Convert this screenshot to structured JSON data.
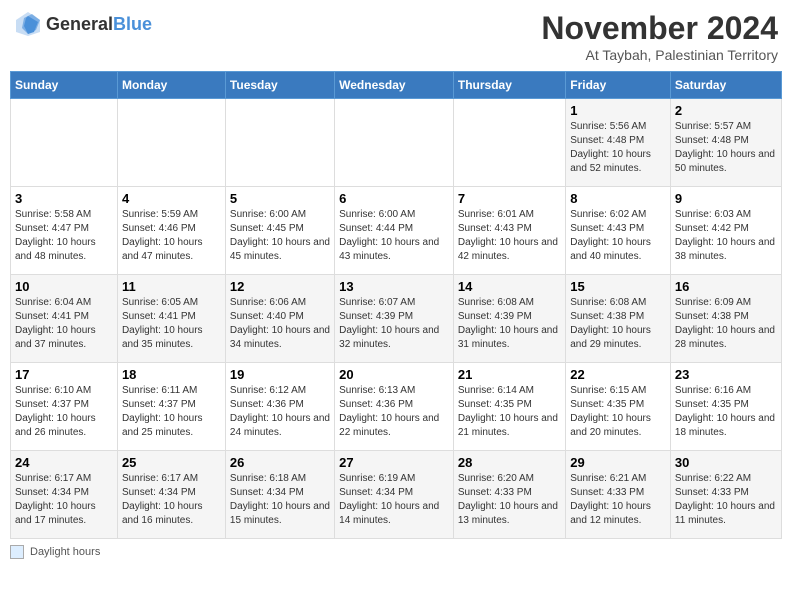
{
  "header": {
    "logo_general": "General",
    "logo_blue": "Blue",
    "month_title": "November 2024",
    "location": "At Taybah, Palestinian Territory"
  },
  "columns": [
    "Sunday",
    "Monday",
    "Tuesday",
    "Wednesday",
    "Thursday",
    "Friday",
    "Saturday"
  ],
  "weeks": [
    [
      {
        "day": "",
        "sunrise": "",
        "sunset": "",
        "daylight": ""
      },
      {
        "day": "",
        "sunrise": "",
        "sunset": "",
        "daylight": ""
      },
      {
        "day": "",
        "sunrise": "",
        "sunset": "",
        "daylight": ""
      },
      {
        "day": "",
        "sunrise": "",
        "sunset": "",
        "daylight": ""
      },
      {
        "day": "",
        "sunrise": "",
        "sunset": "",
        "daylight": ""
      },
      {
        "day": "1",
        "sunrise": "Sunrise: 5:56 AM",
        "sunset": "Sunset: 4:48 PM",
        "daylight": "Daylight: 10 hours and 52 minutes."
      },
      {
        "day": "2",
        "sunrise": "Sunrise: 5:57 AM",
        "sunset": "Sunset: 4:48 PM",
        "daylight": "Daylight: 10 hours and 50 minutes."
      }
    ],
    [
      {
        "day": "3",
        "sunrise": "Sunrise: 5:58 AM",
        "sunset": "Sunset: 4:47 PM",
        "daylight": "Daylight: 10 hours and 48 minutes."
      },
      {
        "day": "4",
        "sunrise": "Sunrise: 5:59 AM",
        "sunset": "Sunset: 4:46 PM",
        "daylight": "Daylight: 10 hours and 47 minutes."
      },
      {
        "day": "5",
        "sunrise": "Sunrise: 6:00 AM",
        "sunset": "Sunset: 4:45 PM",
        "daylight": "Daylight: 10 hours and 45 minutes."
      },
      {
        "day": "6",
        "sunrise": "Sunrise: 6:00 AM",
        "sunset": "Sunset: 4:44 PM",
        "daylight": "Daylight: 10 hours and 43 minutes."
      },
      {
        "day": "7",
        "sunrise": "Sunrise: 6:01 AM",
        "sunset": "Sunset: 4:43 PM",
        "daylight": "Daylight: 10 hours and 42 minutes."
      },
      {
        "day": "8",
        "sunrise": "Sunrise: 6:02 AM",
        "sunset": "Sunset: 4:43 PM",
        "daylight": "Daylight: 10 hours and 40 minutes."
      },
      {
        "day": "9",
        "sunrise": "Sunrise: 6:03 AM",
        "sunset": "Sunset: 4:42 PM",
        "daylight": "Daylight: 10 hours and 38 minutes."
      }
    ],
    [
      {
        "day": "10",
        "sunrise": "Sunrise: 6:04 AM",
        "sunset": "Sunset: 4:41 PM",
        "daylight": "Daylight: 10 hours and 37 minutes."
      },
      {
        "day": "11",
        "sunrise": "Sunrise: 6:05 AM",
        "sunset": "Sunset: 4:41 PM",
        "daylight": "Daylight: 10 hours and 35 minutes."
      },
      {
        "day": "12",
        "sunrise": "Sunrise: 6:06 AM",
        "sunset": "Sunset: 4:40 PM",
        "daylight": "Daylight: 10 hours and 34 minutes."
      },
      {
        "day": "13",
        "sunrise": "Sunrise: 6:07 AM",
        "sunset": "Sunset: 4:39 PM",
        "daylight": "Daylight: 10 hours and 32 minutes."
      },
      {
        "day": "14",
        "sunrise": "Sunrise: 6:08 AM",
        "sunset": "Sunset: 4:39 PM",
        "daylight": "Daylight: 10 hours and 31 minutes."
      },
      {
        "day": "15",
        "sunrise": "Sunrise: 6:08 AM",
        "sunset": "Sunset: 4:38 PM",
        "daylight": "Daylight: 10 hours and 29 minutes."
      },
      {
        "day": "16",
        "sunrise": "Sunrise: 6:09 AM",
        "sunset": "Sunset: 4:38 PM",
        "daylight": "Daylight: 10 hours and 28 minutes."
      }
    ],
    [
      {
        "day": "17",
        "sunrise": "Sunrise: 6:10 AM",
        "sunset": "Sunset: 4:37 PM",
        "daylight": "Daylight: 10 hours and 26 minutes."
      },
      {
        "day": "18",
        "sunrise": "Sunrise: 6:11 AM",
        "sunset": "Sunset: 4:37 PM",
        "daylight": "Daylight: 10 hours and 25 minutes."
      },
      {
        "day": "19",
        "sunrise": "Sunrise: 6:12 AM",
        "sunset": "Sunset: 4:36 PM",
        "daylight": "Daylight: 10 hours and 24 minutes."
      },
      {
        "day": "20",
        "sunrise": "Sunrise: 6:13 AM",
        "sunset": "Sunset: 4:36 PM",
        "daylight": "Daylight: 10 hours and 22 minutes."
      },
      {
        "day": "21",
        "sunrise": "Sunrise: 6:14 AM",
        "sunset": "Sunset: 4:35 PM",
        "daylight": "Daylight: 10 hours and 21 minutes."
      },
      {
        "day": "22",
        "sunrise": "Sunrise: 6:15 AM",
        "sunset": "Sunset: 4:35 PM",
        "daylight": "Daylight: 10 hours and 20 minutes."
      },
      {
        "day": "23",
        "sunrise": "Sunrise: 6:16 AM",
        "sunset": "Sunset: 4:35 PM",
        "daylight": "Daylight: 10 hours and 18 minutes."
      }
    ],
    [
      {
        "day": "24",
        "sunrise": "Sunrise: 6:17 AM",
        "sunset": "Sunset: 4:34 PM",
        "daylight": "Daylight: 10 hours and 17 minutes."
      },
      {
        "day": "25",
        "sunrise": "Sunrise: 6:17 AM",
        "sunset": "Sunset: 4:34 PM",
        "daylight": "Daylight: 10 hours and 16 minutes."
      },
      {
        "day": "26",
        "sunrise": "Sunrise: 6:18 AM",
        "sunset": "Sunset: 4:34 PM",
        "daylight": "Daylight: 10 hours and 15 minutes."
      },
      {
        "day": "27",
        "sunrise": "Sunrise: 6:19 AM",
        "sunset": "Sunset: 4:34 PM",
        "daylight": "Daylight: 10 hours and 14 minutes."
      },
      {
        "day": "28",
        "sunrise": "Sunrise: 6:20 AM",
        "sunset": "Sunset: 4:33 PM",
        "daylight": "Daylight: 10 hours and 13 minutes."
      },
      {
        "day": "29",
        "sunrise": "Sunrise: 6:21 AM",
        "sunset": "Sunset: 4:33 PM",
        "daylight": "Daylight: 10 hours and 12 minutes."
      },
      {
        "day": "30",
        "sunrise": "Sunrise: 6:22 AM",
        "sunset": "Sunset: 4:33 PM",
        "daylight": "Daylight: 10 hours and 11 minutes."
      }
    ]
  ],
  "footer": {
    "label": "Daylight hours"
  }
}
